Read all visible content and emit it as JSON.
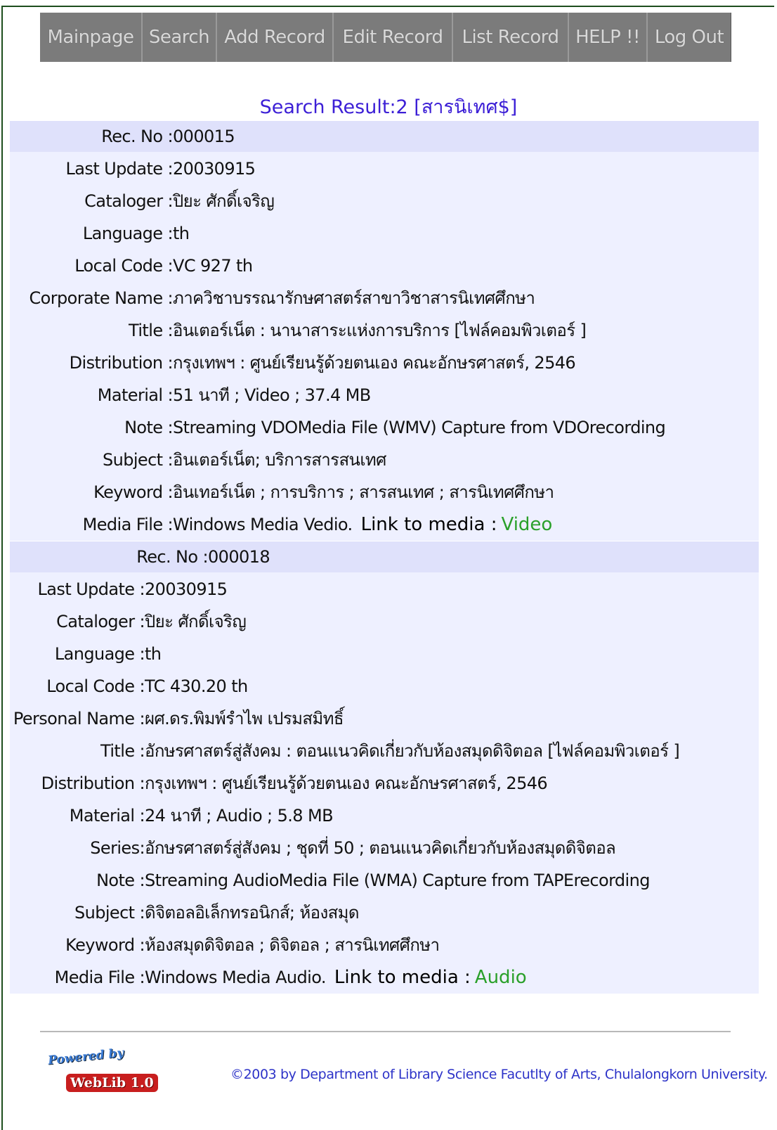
{
  "nav": [
    "Mainpage",
    "Search",
    "Add Record",
    "Edit Record",
    "List Record",
    "HELP !!",
    "Log Out"
  ],
  "result_title": "Search Result:2 [สารนิเทศ$]",
  "records": [
    {
      "rows": [
        {
          "label": "Rec. No",
          "value": "000015"
        },
        {
          "label": "Last Update",
          "value": "20030915"
        },
        {
          "label": "Cataloger",
          "value": "ปิยะ ศักดิ์เจริญ"
        },
        {
          "label": "Language",
          "value": "th"
        },
        {
          "label": "Local Code",
          "value": "VC 927 th"
        },
        {
          "label": "Corporate Name",
          "value": "ภาควิชาบรรณารักษศาสตร์สาขาวิชาสารนิเทศศึกษา"
        },
        {
          "label": "Title",
          "value": "อินเตอร์เน็ต : นานาสาระแห่งการบริการ [ไฟล์คอมพิวเตอร์ ]"
        },
        {
          "label": "Distribution",
          "value": "กรุงเทพฯ : ศูนย์เรียนรู้ด้วยตนเอง คณะอักษรศาสตร์, 2546"
        },
        {
          "label": "Material",
          "value": "51 นาที ; Video ; 37.4 MB"
        },
        {
          "label": "Note",
          "value": "Streaming VDOMedia File (WMV) Capture from VDOrecording"
        },
        {
          "label": "Subject",
          "value": "อินเตอร์เน็ต; บริการสารสนเทศ"
        },
        {
          "label": "Keyword",
          "value": "อินเทอร์เน็ต ; การบริการ ; สารสนเทศ ; สารนิเทศศึกษา"
        }
      ],
      "media": {
        "label": "Media File",
        "value": "Windows Media Vedio.",
        "link_label": "Link to media :",
        "link_text": "Video"
      }
    },
    {
      "rows": [
        {
          "label": "Rec. No",
          "value": "000018"
        },
        {
          "label": "Last Update",
          "value": "20030915"
        },
        {
          "label": "Cataloger",
          "value": "ปิยะ ศักดิ์เจริญ"
        },
        {
          "label": "Language",
          "value": "th"
        },
        {
          "label": "Local Code",
          "value": "TC 430.20 th"
        },
        {
          "label": "Personal Name",
          "value": "ผศ.ดร.พิมพ์รำไพ เปรมสมิทธิ์"
        },
        {
          "label": "Title",
          "value": "อักษรศาสตร์สู่สังคม : ตอนแนวคิดเกี่ยวกับห้องสมุดดิจิตอล [ไฟล์คอมพิวเตอร์ ]"
        },
        {
          "label": "Distribution",
          "value": "กรุงเทพฯ : ศูนย์เรียนรู้ด้วยตนเอง คณะอักษรศาสตร์, 2546"
        },
        {
          "label": "Material",
          "value": "24 นาที ; Audio ; 5.8 MB"
        },
        {
          "label": "Series",
          "value": "อักษรศาสตร์สู่สังคม ; ชุดที่ 50 ; ตอนแนวคิดเกี่ยวกับห้องสมุดดิจิตอล"
        },
        {
          "label": "Note",
          "value": "Streaming AudioMedia File (WMA) Capture from TAPErecording"
        },
        {
          "label": "Subject",
          "value": "ดิจิตอลอิเล็กทรอนิกส์; ห้องสมุด"
        },
        {
          "label": "Keyword",
          "value": "ห้องสมุดดิจิตอล ; ดิจิตอล ; สารนิเทศศึกษา"
        }
      ],
      "media": {
        "label": "Media File",
        "value": "Windows Media Audio.",
        "link_label": "Link to media :",
        "link_text": "Audio"
      }
    }
  ],
  "footer": {
    "powered_by": "Powered by",
    "logo_text": "WebLib 1.0",
    "copyright": "©2003 by Department of Library Science Facutlty of Arts, Chulalongkorn University."
  }
}
